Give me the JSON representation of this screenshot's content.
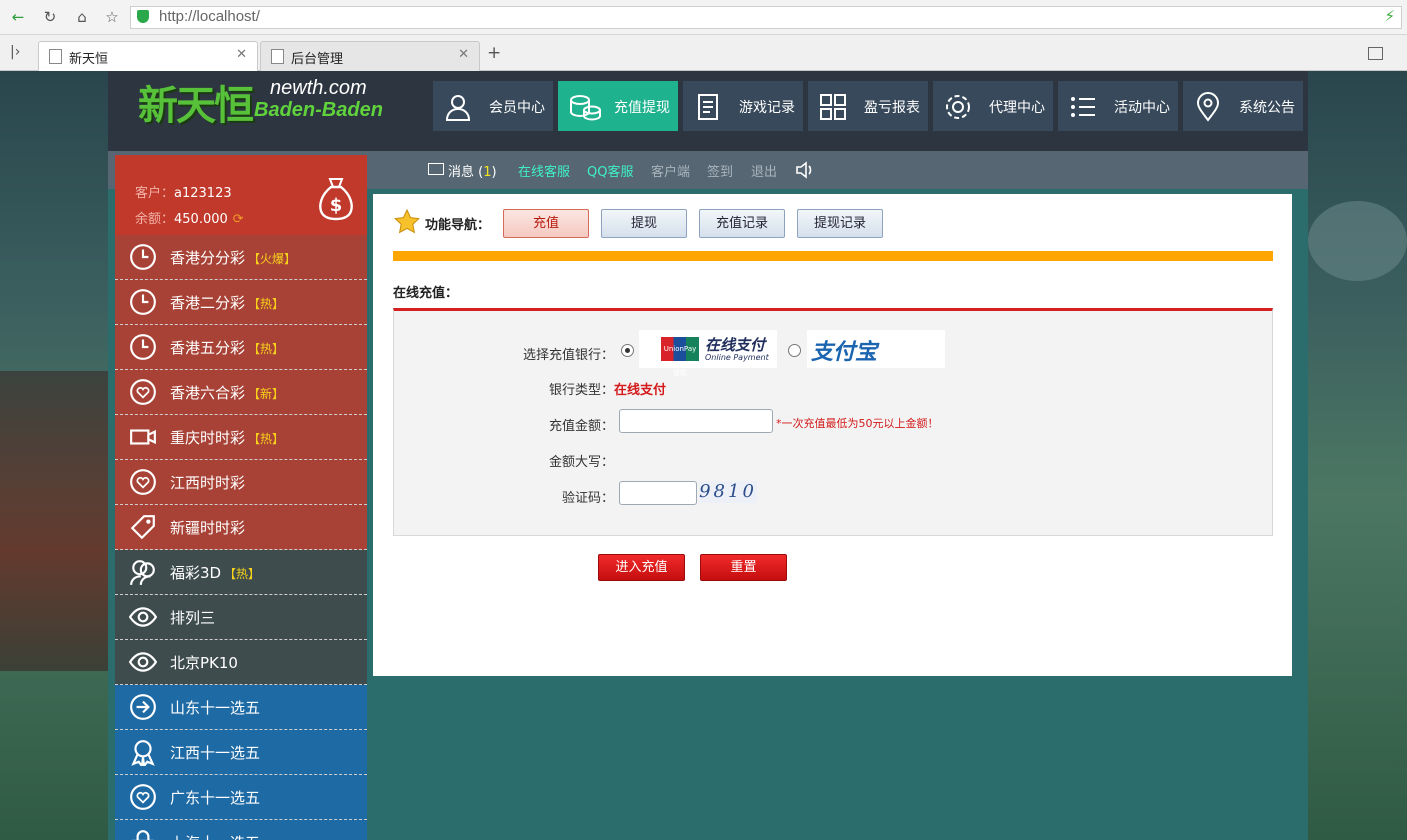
{
  "browser": {
    "url": "http://localhost/",
    "tabs": [
      {
        "label": "新天恒",
        "active": true
      },
      {
        "label": "后台管理",
        "active": false
      }
    ],
    "new_tab_label": "+"
  },
  "header": {
    "logo_cn": "新天恒",
    "logo_domain": "newth.com",
    "logo_en": "Baden-Baden",
    "nav": [
      {
        "label": "会员中心",
        "icon": "user-icon"
      },
      {
        "label": "充值提现",
        "icon": "coins-icon",
        "active": true
      },
      {
        "label": "游戏记录",
        "icon": "document-icon"
      },
      {
        "label": "盈亏报表",
        "icon": "grid-icon"
      },
      {
        "label": "代理中心",
        "icon": "gear-icon"
      },
      {
        "label": "活动中心",
        "icon": "list-icon"
      },
      {
        "label": "系统公告",
        "icon": "location-pin-icon"
      }
    ]
  },
  "subbar": {
    "message_label": "消息",
    "message_count_open": "(",
    "message_count": "1",
    "message_count_close": ")",
    "online_service": "在线客服",
    "qq_service": "QQ客服",
    "client": "客户端",
    "signin": "签到",
    "logout": "退出"
  },
  "account": {
    "customer_label": "客户：",
    "customer_value": "a123123",
    "balance_label": "余额：",
    "balance_value": "450.000"
  },
  "sidebar": {
    "items": [
      {
        "label": "香港分分彩",
        "tag": "【火爆】",
        "icon": "clock-icon",
        "color": "#a84236"
      },
      {
        "label": "香港二分彩",
        "tag": "【热】",
        "icon": "clock-icon",
        "color": "#a84236"
      },
      {
        "label": "香港五分彩",
        "tag": "【热】",
        "icon": "clock-icon",
        "color": "#a84236"
      },
      {
        "label": "香港六合彩",
        "tag": "【新】",
        "icon": "heart-circle-icon",
        "color": "#a84236"
      },
      {
        "label": "重庆时时彩",
        "tag": "【热】",
        "icon": "video-camera-icon",
        "color": "#a84236"
      },
      {
        "label": "江西时时彩",
        "tag": "",
        "icon": "heart-circle-icon",
        "color": "#a84236"
      },
      {
        "label": "新疆时时彩",
        "tag": "",
        "icon": "tag-icon",
        "color": "#a84236"
      },
      {
        "label": "福彩3D",
        "tag": "【热】",
        "icon": "users-icon",
        "color": "#3f4c4d"
      },
      {
        "label": "排列三",
        "tag": "",
        "icon": "eye-icon",
        "color": "#3f4c4d"
      },
      {
        "label": "北京PK10",
        "tag": "",
        "icon": "eye-icon",
        "color": "#3f4c4d"
      },
      {
        "label": "山东十一选五",
        "tag": "",
        "icon": "arrow-circle-icon",
        "color": "#1e6aa5"
      },
      {
        "label": "江西十一选五",
        "tag": "",
        "icon": "award-icon",
        "color": "#1e6aa5"
      },
      {
        "label": "广东十一选五",
        "tag": "",
        "icon": "heart-circle-icon",
        "color": "#1e6aa5"
      },
      {
        "label": "上海十一选五",
        "tag": "",
        "icon": "lock-icon",
        "color": "#1e6aa5"
      }
    ]
  },
  "content": {
    "nav_label": "功能导航：",
    "func_buttons": [
      {
        "label": "充值",
        "active": true
      },
      {
        "label": "提现",
        "active": false
      },
      {
        "label": "充值记录",
        "active": false
      },
      {
        "label": "提现记录",
        "active": false
      }
    ],
    "section_title": "在线充值：",
    "form": {
      "bank_label": "选择充值银行：",
      "unionpay_logo_text": "UnionPay 银联",
      "unionpay_cn": "在线支付",
      "unionpay_en": "Online Payment",
      "alipay_text": "支付宝",
      "bank_type_label": "银行类型：",
      "bank_type_value": "在线支付",
      "amount_label": "充值金额：",
      "amount_value": "",
      "amount_note": "*一次充值最低为50元以上金额！",
      "upper_label": "金额大写：",
      "upper_value": "",
      "captcha_label": "验证码：",
      "captcha_value": "",
      "captcha_text": "9810"
    },
    "submit_label": "进入充值",
    "reset_label": "重置"
  },
  "colors": {
    "accent_green": "#1fb28e",
    "sidebar_red": "#a84236",
    "sidebar_dark": "#3f4c4d",
    "sidebar_blue": "#1e6aa5",
    "progress_orange": "#ffa500",
    "form_red": "#d42020"
  }
}
